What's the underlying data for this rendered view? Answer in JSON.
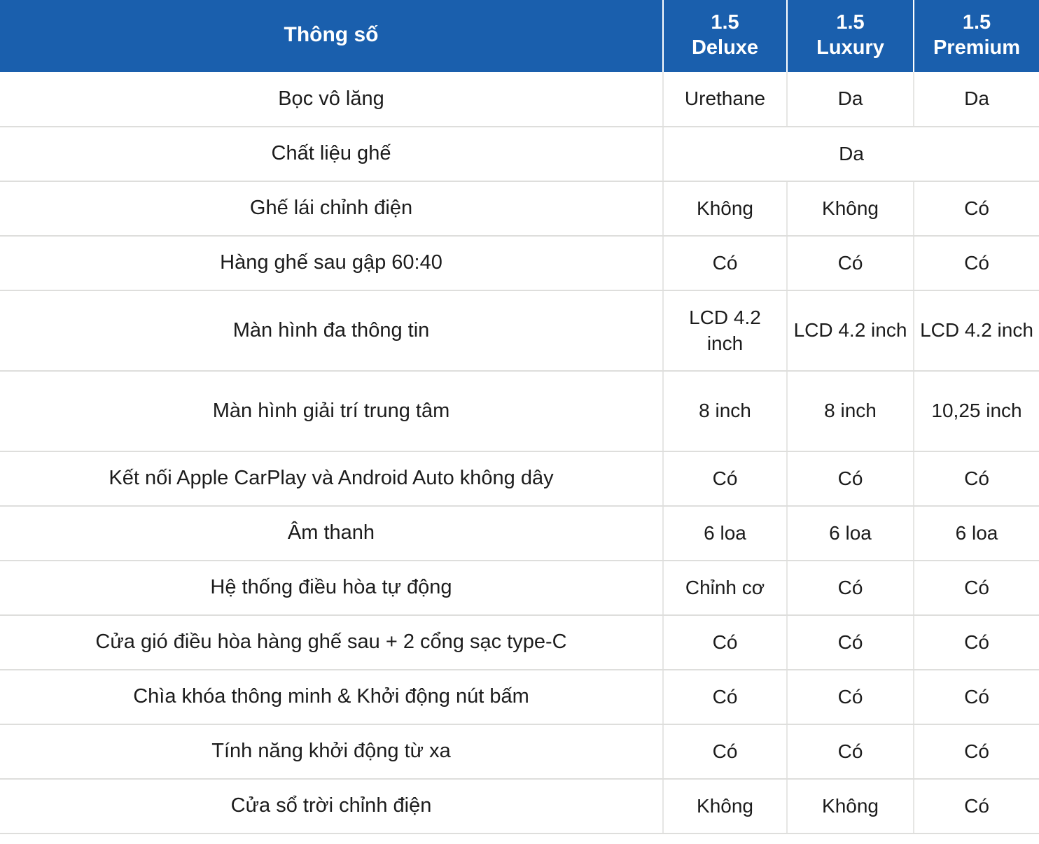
{
  "table": {
    "accent_color": "#1a5fad",
    "header_text_color": "#ffffff",
    "grid_color": "#dededc",
    "headers": {
      "label": "Thông số",
      "variants": [
        {
          "engine": "1.5",
          "trim": "Deluxe"
        },
        {
          "engine": "1.5",
          "trim": "Luxury"
        },
        {
          "engine": "1.5",
          "trim": "Premium"
        }
      ]
    },
    "rows": [
      {
        "label": "Bọc vô lăng",
        "height": "std",
        "merged": false,
        "values": [
          "Urethane",
          "Da",
          "Da"
        ]
      },
      {
        "label": "Chất liệu ghế",
        "height": "std",
        "merged": true,
        "merged_value": "Da",
        "values": [
          "Da",
          "Da",
          "Da"
        ]
      },
      {
        "label": "Ghế lái chỉnh điện",
        "height": "std",
        "merged": false,
        "values": [
          "Không",
          "Không",
          "Có"
        ]
      },
      {
        "label": "Hàng ghế sau gập 60:40",
        "height": "std",
        "merged": false,
        "values": [
          "Có",
          "Có",
          "Có"
        ]
      },
      {
        "label": "Màn hình đa thông tin",
        "height": "tall",
        "merged": false,
        "values": [
          "LCD 4.2 inch",
          "LCD 4.2 inch",
          "LCD 4.2 inch"
        ]
      },
      {
        "label": "Màn hình giải trí trung tâm",
        "height": "tall",
        "merged": false,
        "values": [
          "8 inch",
          "8 inch",
          "10,25 inch"
        ]
      },
      {
        "label": "Kết nối Apple CarPlay và Android Auto không dây",
        "height": "std",
        "merged": false,
        "values": [
          "Có",
          "Có",
          "Có"
        ]
      },
      {
        "label": "Âm thanh",
        "height": "std",
        "merged": false,
        "values": [
          "6 loa",
          "6 loa",
          "6 loa"
        ]
      },
      {
        "label": "Hệ thống điều hòa tự động",
        "height": "std",
        "merged": false,
        "values": [
          "Chỉnh cơ",
          "Có",
          "Có"
        ]
      },
      {
        "label": "Cửa gió điều hòa hàng ghế sau + 2 cổng sạc type-C",
        "height": "std",
        "merged": false,
        "values": [
          "Có",
          "Có",
          "Có"
        ]
      },
      {
        "label": "Chìa khóa thông minh & Khởi động nút bấm",
        "height": "std",
        "merged": false,
        "values": [
          "Có",
          "Có",
          "Có"
        ]
      },
      {
        "label": "Tính năng khởi động từ xa",
        "height": "std",
        "merged": false,
        "values": [
          "Có",
          "Có",
          "Có"
        ]
      },
      {
        "label": "Cửa sổ trời chỉnh điện",
        "height": "std",
        "merged": false,
        "values": [
          "Không",
          "Không",
          "Có"
        ]
      }
    ]
  }
}
